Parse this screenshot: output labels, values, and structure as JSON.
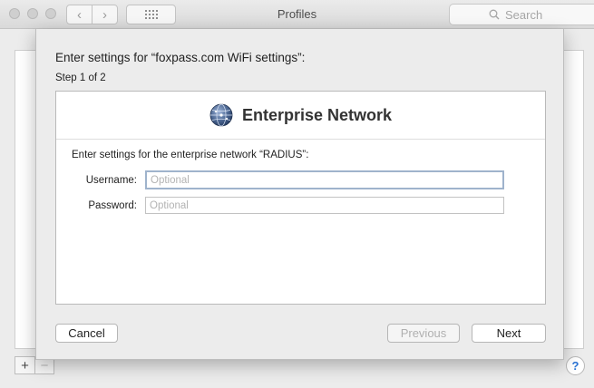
{
  "window": {
    "title": "Profiles"
  },
  "toolbar": {
    "back_glyph": "‹",
    "forward_glyph": "›",
    "search_placeholder": "Search"
  },
  "sheet": {
    "title": "Enter settings for “foxpass.com WiFi settings”:",
    "step": "Step 1 of 2",
    "panel": {
      "heading": "Enterprise Network",
      "intro": "Enter settings for the enterprise network “RADIUS”:",
      "fields": {
        "username": {
          "label": "Username:",
          "placeholder": "Optional",
          "value": ""
        },
        "password": {
          "label": "Password:",
          "placeholder": "Optional",
          "value": ""
        }
      }
    },
    "buttons": {
      "cancel": "Cancel",
      "previous": "Previous",
      "next": "Next"
    }
  },
  "list_controls": {
    "add": "+",
    "remove": "−",
    "help": "?"
  },
  "icons": {
    "globe": "network-globe-icon",
    "search": "search-icon",
    "grid": "show-all-grid-icon"
  },
  "colors": {
    "accent": "#2a74d6",
    "focus_ring": "#9fb3cc"
  }
}
